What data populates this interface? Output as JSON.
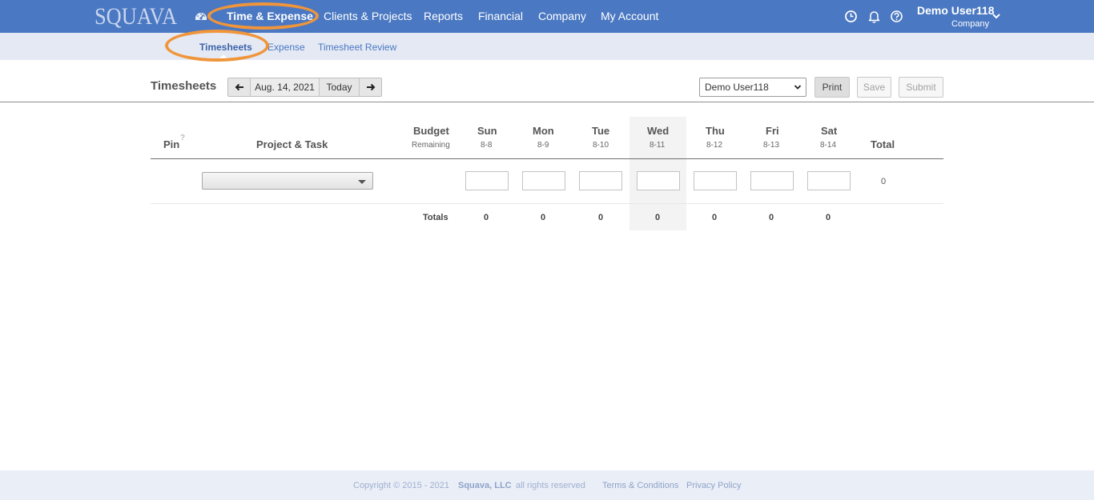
{
  "brand": {
    "logo": "SQUAVA"
  },
  "topnav": {
    "items": [
      {
        "label": "Time & Expense",
        "active": true
      },
      {
        "label": "Clients & Projects"
      },
      {
        "label": "Reports"
      },
      {
        "label": "Financial"
      },
      {
        "label": "Company"
      },
      {
        "label": "My Account"
      }
    ],
    "icons": [
      "clock-icon",
      "bell-icon",
      "help-icon"
    ],
    "user": {
      "name": "Demo User118",
      "company": "Company"
    }
  },
  "subnav": {
    "items": [
      {
        "label": "Timesheets",
        "active": true
      },
      {
        "label": "Expense"
      },
      {
        "label": "Timesheet Review"
      }
    ]
  },
  "toolbar": {
    "title": "Timesheets",
    "date_label": "Aug. 14, 2021",
    "today_label": "Today",
    "user_select_value": "Demo User118",
    "print_label": "Print",
    "save_label": "Save",
    "submit_label": "Submit"
  },
  "table": {
    "pin_label": "Pin",
    "pin_help": "?",
    "project_task_label": "Project & Task",
    "budget_label": "Budget",
    "remaining_label": "Remaining",
    "days": [
      {
        "name": "Sun",
        "date": "8-8"
      },
      {
        "name": "Mon",
        "date": "8-9"
      },
      {
        "name": "Tue",
        "date": "8-10"
      },
      {
        "name": "Wed",
        "date": "8-11",
        "today": true
      },
      {
        "name": "Thu",
        "date": "8-12"
      },
      {
        "name": "Fri",
        "date": "8-13"
      },
      {
        "name": "Sat",
        "date": "8-14"
      }
    ],
    "total_label": "Total",
    "row": {
      "task_value": "",
      "hours": [
        "",
        "",
        "",
        "",
        "",
        "",
        ""
      ],
      "total": "0"
    },
    "totals_label": "Totals",
    "totals": [
      "0",
      "0",
      "0",
      "0",
      "0",
      "0",
      "0"
    ]
  },
  "footer": {
    "copyright": "Copyright © 2015 - 2021",
    "company": "Squava, LLC",
    "rights": "all rights reserved",
    "terms": "Terms & Conditions",
    "privacy": "Privacy Policy"
  },
  "colors": {
    "nav_bg": "#4a78c2",
    "subnav_bg": "#e4e9f4",
    "highlight": "#f0953a"
  }
}
